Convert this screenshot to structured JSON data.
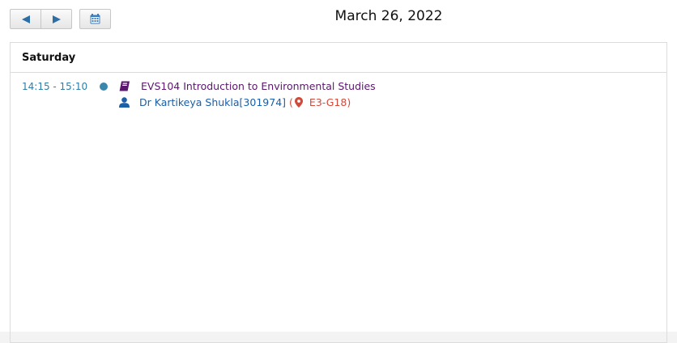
{
  "header": {
    "date_title": "March 26, 2022"
  },
  "icons": {
    "prev": "left-triangle-icon",
    "next": "right-triangle-icon",
    "calendar": "calendar-icon",
    "course": "book-icon",
    "instructor": "user-icon",
    "location": "map-marker-icon"
  },
  "colors": {
    "time": "#2e7ea8",
    "dot": "#3a87ad",
    "course": "#5b1670",
    "instructor": "#1a5fa8",
    "room": "#d04a3c"
  },
  "day": {
    "label": "Saturday",
    "events": [
      {
        "time": "14:15 - 15:10",
        "course": "EVS104 Introduction to Environmental Studies",
        "instructor": "Dr Kartikeya Shukla[301974]",
        "room_open": "(",
        "room": "E3-G18)"
      }
    ]
  }
}
